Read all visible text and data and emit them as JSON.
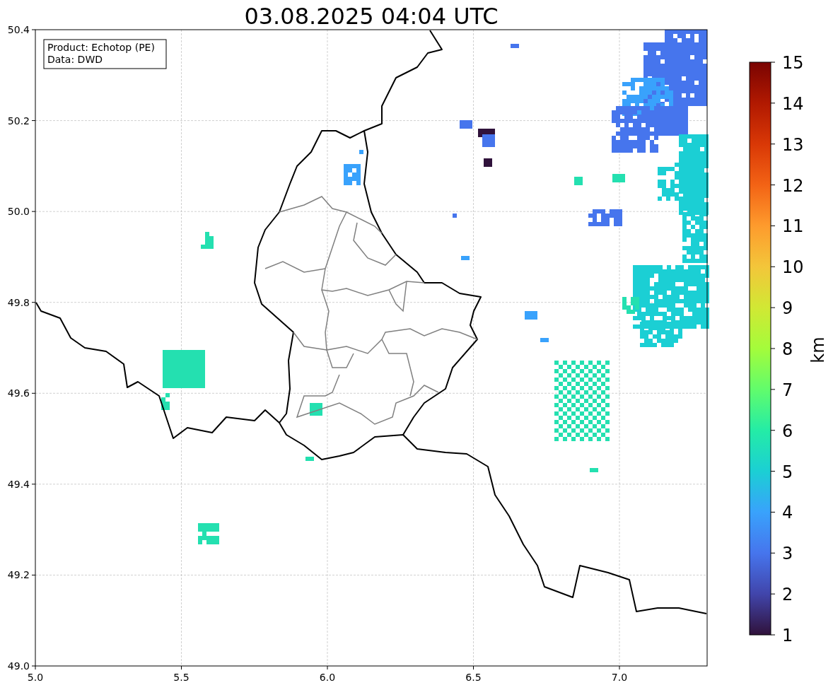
{
  "title": "03.08.2025 04:04 UTC",
  "info_box": {
    "lines": [
      "Product: Echotop (PE)",
      "Data: DWD"
    ]
  },
  "map": {
    "y_ticks": [
      "50.4",
      "50.2",
      "50.0",
      "49.8",
      "49.6",
      "49.4",
      "49.2",
      "49.0"
    ],
    "x_ticks": [
      "5.0",
      "5.5",
      "6.0",
      "6.5",
      "7.0"
    ]
  },
  "colorbar": {
    "label": "km",
    "ticks": [
      "15",
      "14",
      "13",
      "12",
      "11",
      "10",
      "9",
      "8",
      "7",
      "6",
      "5",
      "4",
      "3",
      "2",
      "1"
    ]
  }
}
